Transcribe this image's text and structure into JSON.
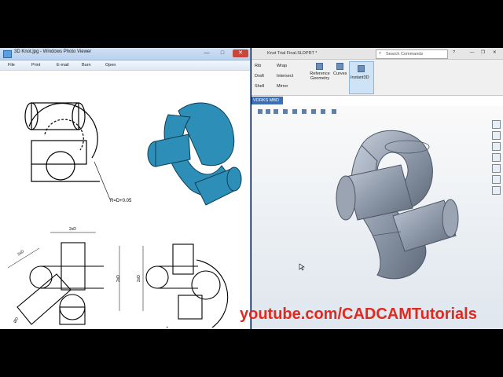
{
  "photo_viewer": {
    "window_title": "3D Knot.jpg - Windows Photo Viewer",
    "menu": [
      "File",
      "Print",
      "E-mail",
      "Burn",
      "Open"
    ],
    "dims": {
      "radius": "R=D+0.05",
      "width_top": "2xD",
      "diag": "2xD",
      "height": "2xD",
      "phi": "ØD",
      "side": "2xD"
    }
  },
  "solidworks": {
    "doc_title": "Knot Trial Final.SLDPRT *",
    "search_placeholder": "Search Commands",
    "ribbon_items": [
      "Rib",
      "Draft",
      "Shell",
      "Wrap",
      "Intersect",
      "Mirror",
      "Reference Geometry",
      "Curves",
      "Instant3D"
    ],
    "tab": "VORKS MBD"
  },
  "banner": "youtube.com/CADCAMTutorials",
  "colors": {
    "model_blue": "#2d8fb8",
    "sw_gray": "#8d98a8",
    "banner_red": "#e0291f"
  }
}
